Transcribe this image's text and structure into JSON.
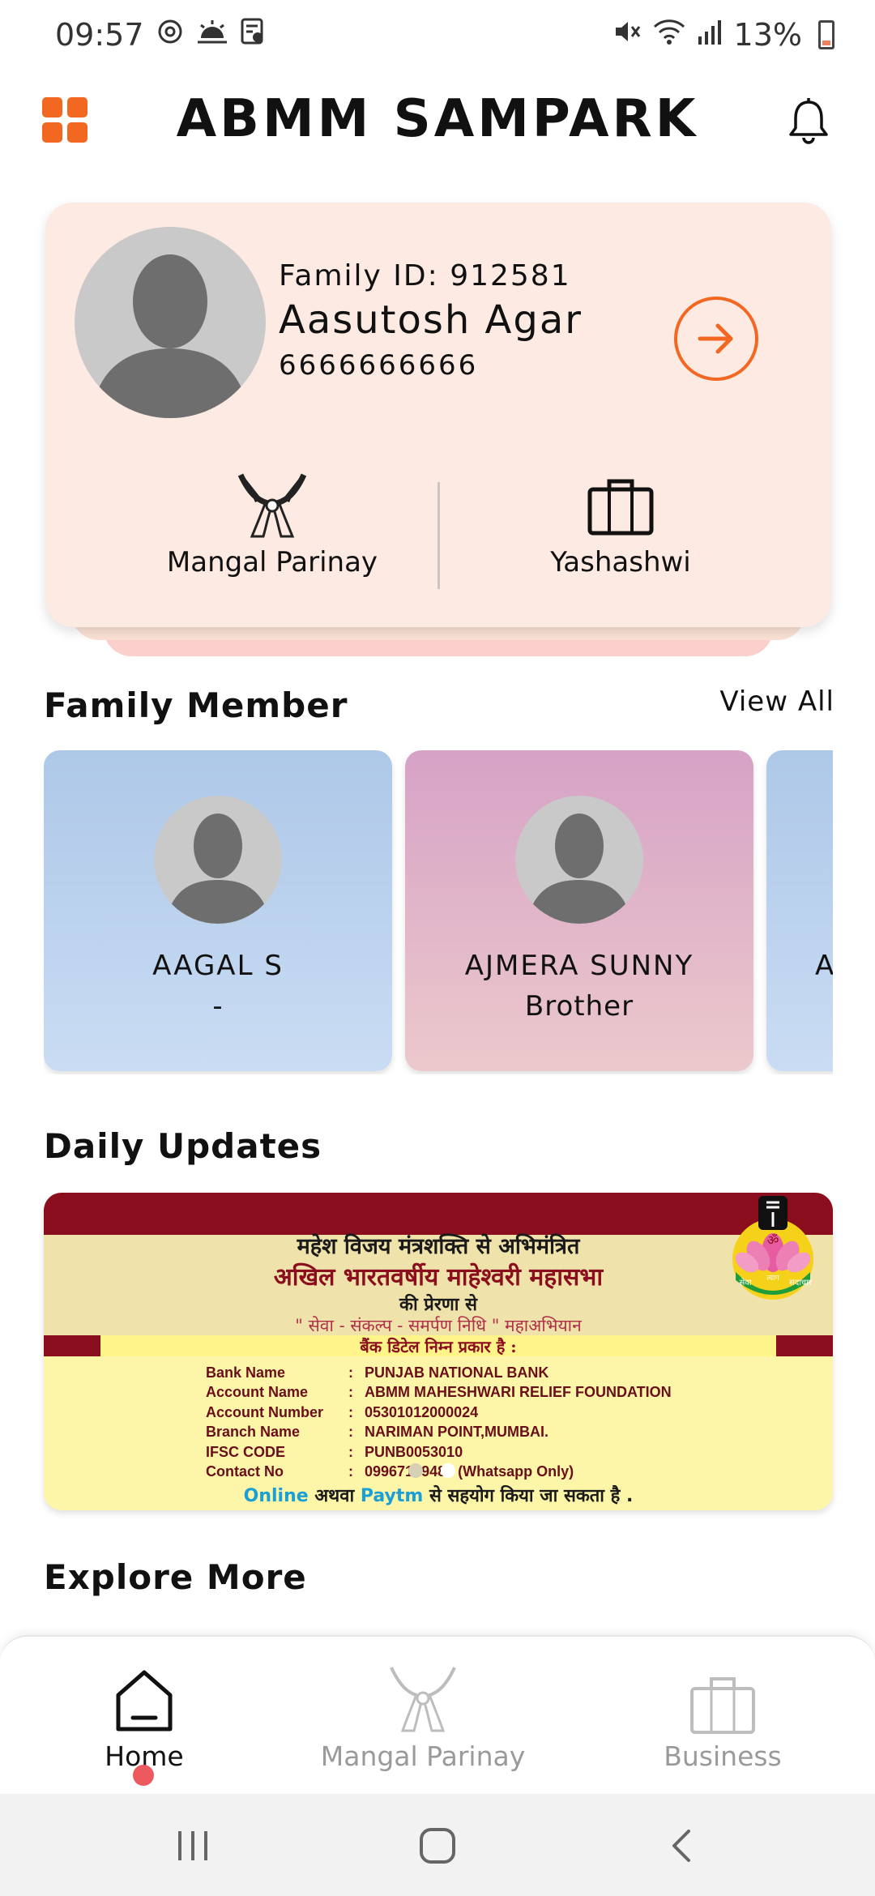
{
  "status_bar": {
    "time": "09:57",
    "battery": "13%",
    "left_icons": [
      "sync-icon",
      "weather-icon",
      "note-icon"
    ],
    "right_icons": [
      "mute-icon",
      "wifi-icon",
      "signal-icon",
      "battery-icon"
    ]
  },
  "app_bar": {
    "title": "ABMM SAMPARK",
    "menu_icon": "grid-menu-icon",
    "notification_icon": "bell-icon",
    "accent_color": "#f26722"
  },
  "profile": {
    "family_id": "Family ID: 912581",
    "name": "Aasutosh Agar",
    "phone": "6666666666",
    "actions": [
      {
        "label": "Mangal Parinay",
        "icon": "garland-icon"
      },
      {
        "label": "Yashashwi",
        "icon": "briefcase-icon"
      }
    ],
    "card_color": "#fdeae3"
  },
  "family_section": {
    "title": "Family Member",
    "view_all": "View All",
    "members": [
      {
        "name": "AAGAL S",
        "relation": "-"
      },
      {
        "name": "AJMERA SUNNY",
        "relation": "Brother"
      },
      {
        "name": "A",
        "relation": ""
      }
    ]
  },
  "daily_updates": {
    "title": "Daily Updates",
    "banner": {
      "line1": "महेश विजय मंत्रशक्ति से अभिमंत्रित",
      "line2": "अखिल भारतवर्षीय माहेश्वरी महासभा",
      "line3": "की प्रेरणा से",
      "line4": "\" सेवा - संकल्प - समर्पण निधि \" महाअभियान",
      "line5": "बैंक डिटेल निम्न प्रकार है :",
      "bank_details": [
        {
          "key": "Bank Name",
          "value": "PUNJAB NATIONAL BANK"
        },
        {
          "key": "Account Name",
          "value": "ABMM MAHESHWARI RELIEF FOUNDATION"
        },
        {
          "key": "Account Number",
          "value": "05301012000024"
        },
        {
          "key": "Branch Name",
          "value": "NARIMAN POINT,MUMBAI."
        },
        {
          "key": "IFSC CODE",
          "value": "PUNB0053010"
        },
        {
          "key": "Contact No",
          "value": "09967179489 (Whatsapp Only)"
        }
      ],
      "colon": ":",
      "footer_online": "Online",
      "footer_or": "अथवा",
      "footer_paytm": "Paytm",
      "footer_rest": "से सहयोग किया जा सकता है .",
      "logo_text": {
        "top": "ॐ",
        "left": "सेवा",
        "middle": "त्याग",
        "right": "सदाचार"
      },
      "slide_count": 2,
      "active_slide": 2
    }
  },
  "explore_more": {
    "title": "Explore More"
  },
  "bottom_nav": {
    "items": [
      {
        "label": "Home",
        "icon": "home-icon",
        "active": true
      },
      {
        "label": "Mangal Parinay",
        "icon": "garland-icon",
        "active": false
      },
      {
        "label": "Business",
        "icon": "briefcase-icon",
        "active": false
      }
    ],
    "active_dot_color": "#ec5a5f"
  },
  "system_nav": {
    "items": [
      "recents-icon",
      "home-button-icon",
      "back-icon"
    ]
  }
}
